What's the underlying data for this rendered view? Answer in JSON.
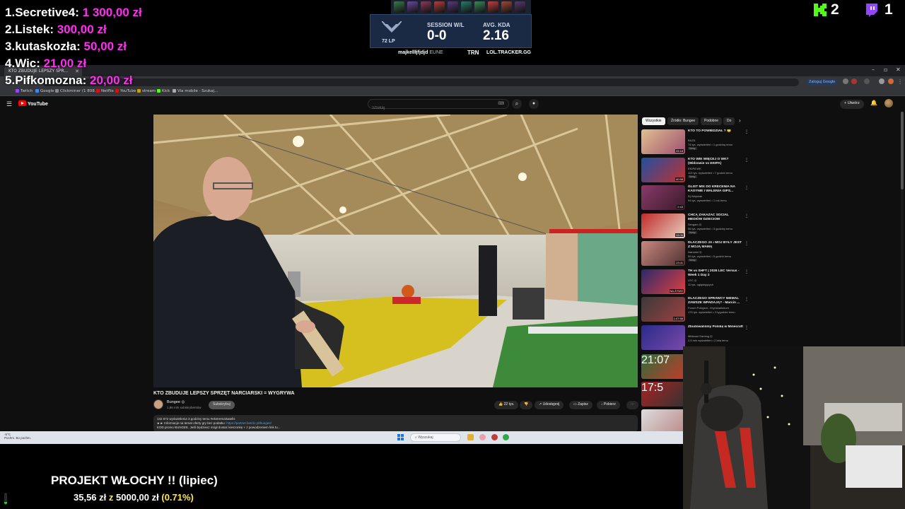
{
  "overlay": {
    "donors": [
      {
        "rank": "1.",
        "name": "Secretive4:",
        "amount": "1 300,00 zł"
      },
      {
        "rank": "2.",
        "name": "Listek:",
        "amount": "300,00 zł"
      },
      {
        "rank": "3.",
        "name": "kutaskozła:",
        "amount": "50,00 zł"
      },
      {
        "rank": "4.",
        "name": "Wic:",
        "amount": "21,00 zł"
      },
      {
        "rank": "5.",
        "name": "Pifkomozna:",
        "amount": "20,00 zł"
      }
    ],
    "kick_viewers": "2",
    "twitch_viewers": "1",
    "tracker": {
      "lp": "72 LP",
      "session_label": "SESSION W/L",
      "session_value": "0-0",
      "kda_label": "AVG. KDA",
      "kda_value": "2.16",
      "summoner": "majkellłjfjdjd",
      "region": "EUNE",
      "brand": "TRN",
      "site": "LOL.TRACKER.GG"
    },
    "goal": {
      "title": "PROJEKT WŁOCHY !! (lipiec)",
      "current": "35,56 zł",
      "of": "z",
      "target": "5000,00 zł",
      "percent": "(0.71%)",
      "progress": 0.0071
    }
  },
  "browser": {
    "tab_title": "KTO ZBUDUJE LEPSZY SPR...",
    "google_signin": "Zaloguj Google",
    "bookmarks": [
      "Twitch",
      "Google",
      "Clickminer (1 808...",
      "Netflix",
      "YouTube",
      "stream",
      "Kick",
      "Via mobile · Szukaj..."
    ]
  },
  "youtube": {
    "logo_text": "YouTube",
    "search_placeholder": "Szukaj",
    "create_label": "Utwórz",
    "video_title": "KTO ZBUDUJE LEPSZY SPRZĘT NARCIARSKI = WYGRYWA",
    "channel_name": "Bungee ◎",
    "channel_subs": "1,86 mln subskrybentów",
    "subscribe_label": "Subskrybuj",
    "likes": "22 tys.",
    "share_label": "Udostępnij",
    "save_label": "Zapisz",
    "download_label": "Pobierz",
    "desc_line1": "132 872 wyświetlenia  3 godziny temu  #ekstremalsatells",
    "desc_line2_text": "►► Informacje na temat oferty gry bez podatku: ",
    "desc_line2_link": "https://partner.betclic.pl/bungee/",
    "desc_line3": "KOD promo BUNGEE. Jeśli będziesz mógł dostać kieszonkę + z powodzeniem link tu...",
    "chips": [
      "Wszystkie",
      "Źródło: Bungee",
      "Podobne",
      "Do"
    ],
    "recommendations": [
      {
        "title": "KTO TO POWIEDZIAŁ ? 🙂",
        "channel": "BAZA",
        "meta": "74 tys. wyświetleń • 1 godzinę temu",
        "badge": "Nowy",
        "duration": "25:18"
      },
      {
        "title": "KTO WIE WIĘCEJ O WK? (Widzowie vs EKIPA)",
        "channel": "EKIPA WK",
        "meta": "113 tys. wyświetleń • 7 godzin temu",
        "badge": "Nowy",
        "duration": "40:58"
      },
      {
        "title": "GLIŚT MIX DO KRECENIA NA KASYNIE I WALENIA GIPS...",
        "channel": "Dj Wapniak",
        "meta": "94 tys. wyświetleń • 1 rok temu",
        "badge": "",
        "duration": "2:43"
      },
      {
        "title": "CHCĄ ZAKAZAĆ SOCIAL MEDIÓW DZIECIOM",
        "channel": "Sexgam ◎",
        "meta": "56 tys. wyświetleń • 3 godziny temu",
        "badge": "Nowy",
        "duration": "28:06"
      },
      {
        "title": "DLACZEGO JA i MÓJ BYŁY JEST Z MOJĄ MAMĄ",
        "channel": "Narorski ◎",
        "meta": "59 tys. wyświetleń • 5 godzin temu",
        "badge": "Nowy",
        "duration": "23:11"
      },
      {
        "title": "TH vs SHFT | 2026 LEC Versus - Week 1 Day 2",
        "channel": "LEC ◎",
        "meta": "11 tys. oglądających",
        "badge": "",
        "duration": "NA ŻYWO"
      },
      {
        "title": "DLACZEGO SPRAWCY NIEMAL ZAWSZE WPADAJĄ? - Marcin ...",
        "channel": "Forum Policjant - Kryminalistrum",
        "meta": "176 tys. wyświetleń • 3 tygodnie temu",
        "badge": "",
        "duration": "1:07:58"
      },
      {
        "title": "Zbudowaliśmy Polskę w Minecraft",
        "channel": "Mildeast Gaming ◎",
        "meta": "2,5 mln wyświetleń • 2 lata temu",
        "badge": "",
        "duration": ""
      }
    ],
    "extra_durations": [
      "21:07",
      "17:5"
    ]
  },
  "taskbar": {
    "weather_temp": "-5°C",
    "weather_desc": "Pochm. Bo pochm.",
    "search_placeholder": "Wyszukaj"
  },
  "colors": {
    "donor_amount": "#ff2ef0",
    "goal_target": "#ffe74a",
    "kick_green": "#53fc18",
    "twitch_purple": "#9146ff",
    "youtube_red": "#ff0000"
  }
}
